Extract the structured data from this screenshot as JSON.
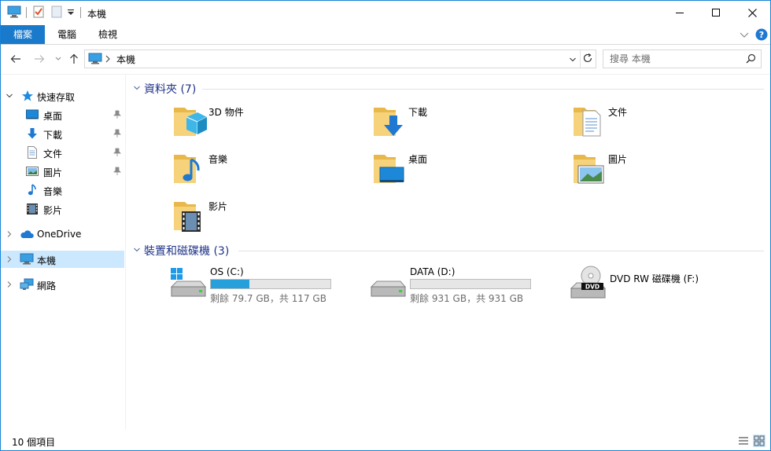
{
  "window": {
    "title": "本機"
  },
  "ribbon": {
    "tabs": [
      "檔案",
      "電腦",
      "檢視"
    ]
  },
  "address": {
    "path": [
      "本機"
    ]
  },
  "search": {
    "placeholder": "搜尋 本機"
  },
  "nav": {
    "quick_access": "快速存取",
    "quick_items": [
      {
        "label": "桌面",
        "pinned": true
      },
      {
        "label": "下載",
        "pinned": true
      },
      {
        "label": "文件",
        "pinned": true
      },
      {
        "label": "圖片",
        "pinned": true
      },
      {
        "label": "音樂",
        "pinned": false
      },
      {
        "label": "影片",
        "pinned": false
      }
    ],
    "onedrive": "OneDrive",
    "this_pc": "本機",
    "network": "網路"
  },
  "folders": {
    "header": "資料夾 (7)",
    "items": [
      {
        "name": "3D 物件",
        "icon": "3d-objects-folder-icon"
      },
      {
        "name": "下載",
        "icon": "downloads-folder-icon"
      },
      {
        "name": "文件",
        "icon": "documents-folder-icon"
      },
      {
        "name": "音樂",
        "icon": "music-folder-icon"
      },
      {
        "name": "桌面",
        "icon": "desktop-folder-icon"
      },
      {
        "name": "圖片",
        "icon": "pictures-folder-icon"
      },
      {
        "name": "影片",
        "icon": "videos-folder-icon"
      }
    ]
  },
  "drives": {
    "header": "裝置和磁碟機 (3)",
    "items": [
      {
        "name": "OS (C:)",
        "free_text": "剩餘 79.7 GB，共 117 GB",
        "used_fraction": 0.32,
        "icon": "windows-drive-icon"
      },
      {
        "name": "DATA (D:)",
        "free_text": "剩餘 931 GB，共 931 GB",
        "used_fraction": 0.0,
        "icon": "hard-drive-icon"
      },
      {
        "name": "DVD RW 磁碟機 (F:)",
        "icon": "dvd-drive-icon"
      }
    ]
  },
  "status": {
    "item_count": "10 個項目"
  },
  "colors": {
    "accent": "#1979ca",
    "selection": "#cce8ff",
    "group_header": "#1e3287",
    "capacity_bar": "#26a0da"
  }
}
